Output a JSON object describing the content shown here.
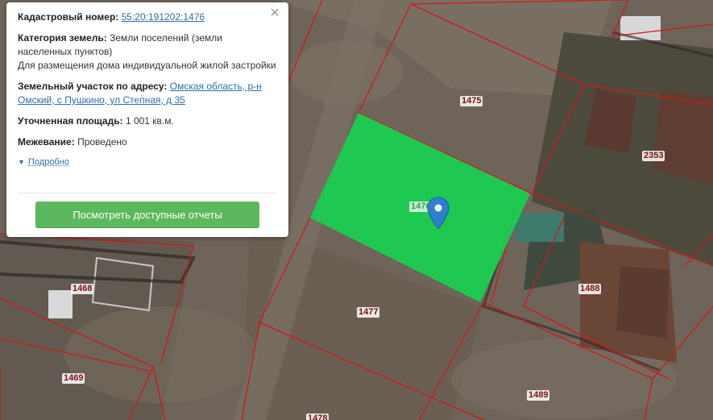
{
  "popup": {
    "cadastral_label": "Кадастровый номер:",
    "cadastral_number": "55:20:191202:1476",
    "category_label": "Категория земель:",
    "category_value": "Земли поселений (земли населенных пунктов)",
    "use_value": "Для размещения дома индивидуальной жилой застройки",
    "address_label": "Земельный участок по адресу:",
    "address_value": "Омская область, р-н Омский, с Пушкино, ул Степная, д 35",
    "area_label": "Уточненная площадь:",
    "area_value": "1 001 кв.м.",
    "survey_label": "Межевание:",
    "survey_value": "Проведено",
    "details_link": "Подробно",
    "report_button": "Посмотреть доступные отчеты",
    "close_icon": "close-icon"
  },
  "map": {
    "selected_parcel_label": "1476",
    "parcel_labels": [
      "1475",
      "2353",
      "1468",
      "1477",
      "1488",
      "1469",
      "1489",
      "1478"
    ],
    "pin_icon": "map-marker-icon",
    "colors": {
      "boundary": "#d01818",
      "selected_fill": "#18d050",
      "pin": "#2f7fd0",
      "button": "#5cb85c",
      "link": "#2a6fb0"
    }
  }
}
